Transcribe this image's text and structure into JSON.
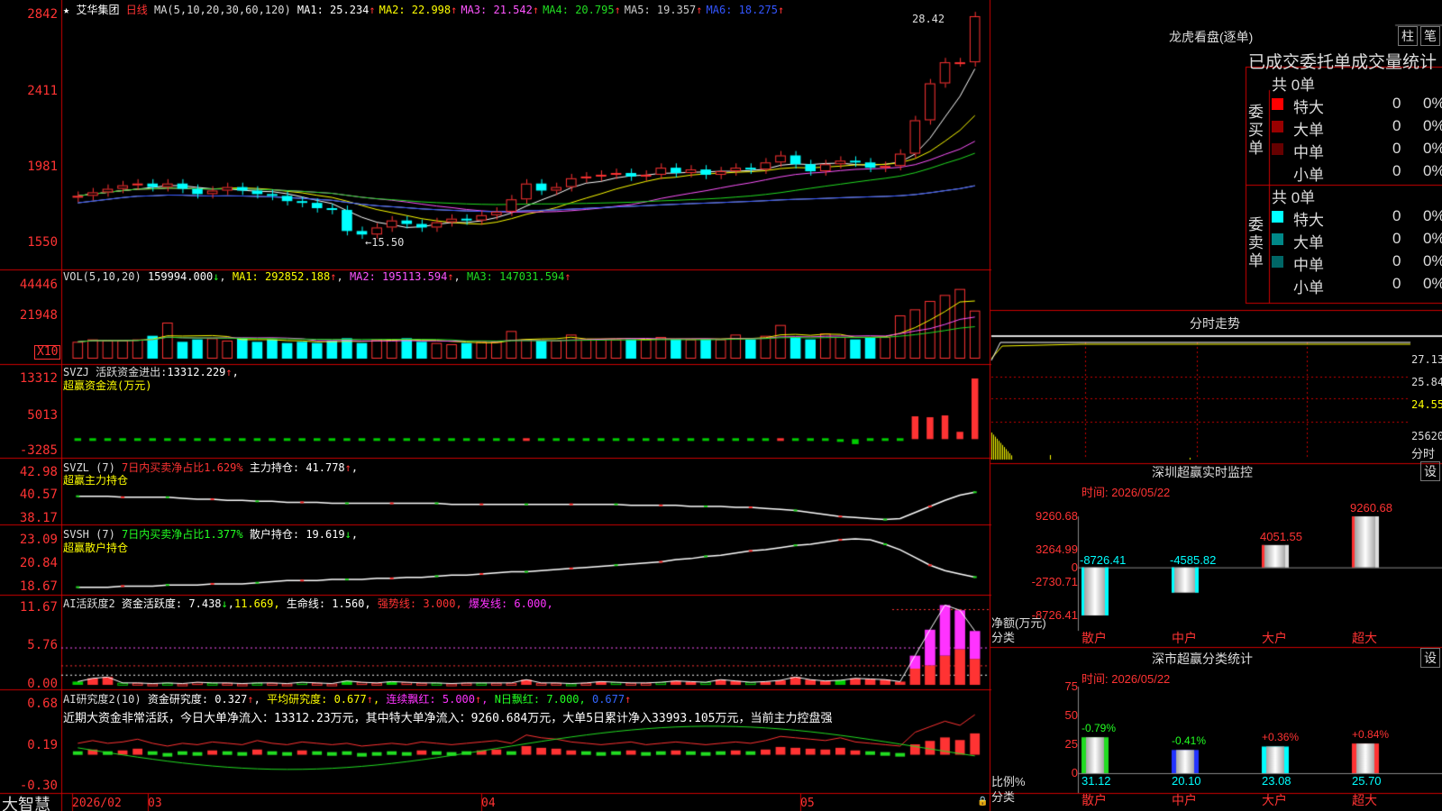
{
  "app": {
    "brand": "大智慧",
    "stock_name": "艾华集团",
    "period": "日线",
    "star": "★"
  },
  "price_panel": {
    "ma_label": "MA(5,10,20,30,60,120)",
    "ma_items": [
      {
        "name": "MA1:",
        "value": "25.234",
        "arrow": "↑",
        "color": "#ffffff"
      },
      {
        "name": "MA2:",
        "value": "22.998",
        "arrow": "↑",
        "color": "#ffff00"
      },
      {
        "name": "MA3:",
        "value": "21.542",
        "arrow": "↑",
        "color": "#ff55ff"
      },
      {
        "name": "MA4:",
        "value": "20.795",
        "arrow": "↑",
        "color": "#22dd22"
      },
      {
        "name": "MA5:",
        "value": "19.357",
        "arrow": "↑",
        "color": "#cccccc"
      },
      {
        "name": "MA6:",
        "value": "18.275",
        "arrow": "↑",
        "color": "#3355ff"
      }
    ],
    "axis": [
      "2842",
      "2411",
      "1981",
      "1550"
    ],
    "high_label": "28.42",
    "low_label": "←15.50"
  },
  "vol_panel": {
    "label": "VOL(5,10,20)",
    "value": "159994.000",
    "arrow": "↓",
    "items": [
      {
        "name": "MA1:",
        "value": "292852.188",
        "arrow": "↑",
        "color": "#ffff00"
      },
      {
        "name": "MA2:",
        "value": "195113.594",
        "arrow": "↑",
        "color": "#ff55ff"
      },
      {
        "name": "MA3:",
        "value": "147031.594",
        "arrow": "↑",
        "color": "#22dd22"
      }
    ],
    "axis": [
      "44446",
      "21948"
    ],
    "unit": "X10"
  },
  "svzj_panel": {
    "label": "SVZJ",
    "line1": "活跃资金进出:",
    "value": "13312.229",
    "arrow": "↑",
    "sep": ",",
    "line2": "超赢资金流(万元)",
    "axis": [
      "13312",
      "5013",
      "-3285"
    ]
  },
  "svzl_panel": {
    "label": "SVZL (7)",
    "text1": "7日内买卖净占比1.629%",
    "text2": "主力持仓:",
    "value": "41.778",
    "arrow": "↑",
    "sep": ",",
    "line2": "超赢主力持仓",
    "axis": [
      "42.98",
      "40.57",
      "38.17"
    ]
  },
  "svsh_panel": {
    "label": "SVSH (7)",
    "text1": "7日内买卖净占比1.377%",
    "text2": "散户持仓:",
    "value": "19.619",
    "arrow": "↓",
    "sep": ",",
    "line2": "超赢散户持仓",
    "axis": [
      "23.09",
      "20.84",
      "18.67"
    ]
  },
  "ai_panel": {
    "label": "AI活跃度2",
    "text1": "资金活跃度:",
    "v1": "7.438",
    "a1": "↓",
    "sep1": ",",
    "v2": "11.669",
    "text3": "生命线:",
    "v3": "1.560",
    "t4": "强势线:",
    "v4": "3.000",
    "t5": "爆发线:",
    "v5": "6.000",
    "sep": ",",
    "axis": [
      "11.67",
      "5.76",
      "0.00"
    ]
  },
  "research_panel": {
    "label": "AI研究度2(10)",
    "t1": "资金研究度:",
    "v1": "0.327",
    "a1": "↑",
    "t2": "平均研究度:",
    "v2": "0.677",
    "a2": "↑",
    "t3": "连续飘红:",
    "v3": "5.000",
    "a3": "↑",
    "t4": "N日飘红:",
    "v4": "7.000",
    "v5": "0.677",
    "a5": "↑",
    "sep": ",",
    "summary": "近期大资金非常活跃，今日大单净流入：13312.23万元，其中特大单净流入：9260.684万元，大单5日累计净入33993.105万元，当前主力控盘强",
    "axis": [
      "0.68",
      "0.19",
      "-0.30"
    ]
  },
  "dates": [
    "2026/02",
    "03",
    "04",
    "05"
  ],
  "right": {
    "dragon_title": "龙虎看盘(逐单)",
    "btn_bar": "柱",
    "btn_pen": "笔",
    "tabs": [
      "已成交委托单成交量统计"
    ],
    "buy": {
      "side": "委买单",
      "total": "共 0单",
      "rows": [
        {
          "label": "特大",
          "v": "0",
          "p": "0%",
          "color": "#ff0000"
        },
        {
          "label": "大单",
          "v": "0",
          "p": "0%",
          "color": "#990000"
        },
        {
          "label": "中单",
          "v": "0",
          "p": "0%",
          "color": "#660000"
        },
        {
          "label": "小单",
          "v": "0",
          "p": "0%",
          "color": ""
        }
      ]
    },
    "sell": {
      "side": "委卖单",
      "total": "共 0单",
      "rows": [
        {
          "label": "特大",
          "v": "0",
          "p": "0%",
          "color": "#00ffff"
        },
        {
          "label": "大单",
          "v": "0",
          "p": "0%",
          "color": "#008888"
        },
        {
          "label": "中单",
          "v": "0",
          "p": "0%",
          "color": "#006666"
        },
        {
          "label": "小单",
          "v": "0",
          "p": "0%",
          "color": ""
        }
      ]
    },
    "ts_title": "分时走势",
    "ts_axis": [
      "27.13",
      "25.84",
      "24.55",
      "25620"
    ],
    "ts_unit": "分时",
    "monitor": {
      "title": "深圳超赢实时监控",
      "btn": "设",
      "time": "时间: 2026/05/22",
      "axis": [
        "9260.68",
        "3264.99",
        "0",
        "-2730.71",
        "-8726.41"
      ],
      "ylabel": "净额(万元)",
      "xlabel": "分类",
      "cats": [
        "散户",
        "中户",
        "大户",
        "超大"
      ],
      "values": [
        -8726.41,
        -4585.82,
        4051.55,
        9260.68
      ],
      "labels": [
        "-8726.41",
        "-4585.82",
        "4051.55",
        "9260.68"
      ]
    },
    "stat": {
      "title": "深市超赢分类统计",
      "btn": "设",
      "time": "时间: 2026/05/22",
      "axis": [
        "75",
        "50",
        "25",
        "0"
      ],
      "ylabel": "比例%",
      "xlabel": "分类",
      "cats": [
        "散户",
        "中户",
        "大户",
        "超大"
      ],
      "values": [
        31.12,
        20.1,
        23.08,
        25.7
      ],
      "labels": [
        "31.12",
        "20.10",
        "23.08",
        "25.70"
      ],
      "changes": [
        "-0.79%",
        "-0.41%",
        "+0.36%",
        "+0.84%"
      ]
    }
  },
  "chart_data": {
    "type": "candlestick",
    "ylim": [
      15.5,
      28.42
    ],
    "closes": [
      18.2,
      18.4,
      18.6,
      18.8,
      18.9,
      18.7,
      18.9,
      18.6,
      18.3,
      18.5,
      18.7,
      18.5,
      18.3,
      18.2,
      17.9,
      17.8,
      17.5,
      17.4,
      16.2,
      16.0,
      16.4,
      16.8,
      16.6,
      16.4,
      16.7,
      16.9,
      16.8,
      17.1,
      17.3,
      18.0,
      18.9,
      18.5,
      18.7,
      19.2,
      19.3,
      19.4,
      19.5,
      19.3,
      19.4,
      19.8,
      19.5,
      19.7,
      19.4,
      19.6,
      19.8,
      19.7,
      20.1,
      20.5,
      20.0,
      19.6,
      20.0,
      20.2,
      20.1,
      19.8,
      19.9,
      20.6,
      22.5,
      24.6,
      25.8,
      25.8,
      28.42
    ],
    "volumes": [
      1.4,
      1.6,
      1.5,
      1.5,
      1.6,
      1.9,
      3.0,
      1.4,
      1.6,
      1.7,
      1.5,
      1.7,
      1.4,
      1.6,
      1.3,
      1.4,
      1.3,
      1.5,
      1.7,
      1.3,
      1.6,
      1.6,
      1.7,
      1.4,
      1.3,
      1.2,
      1.3,
      1.4,
      1.4,
      2.3,
      1.6,
      1.5,
      1.5,
      2.0,
      1.6,
      1.6,
      1.6,
      1.6,
      1.6,
      1.8,
      1.6,
      1.6,
      1.6,
      1.6,
      2.0,
      1.6,
      1.9,
      2.8,
      1.8,
      1.6,
      2.1,
      1.8,
      1.6,
      1.8,
      1.8,
      3.6,
      4.1,
      4.8,
      5.3,
      5.8,
      4.0
    ],
    "svzj": [
      -0.2,
      -0.1,
      -0.2,
      -0.2,
      -0.1,
      -0.3,
      -0.1,
      -0.2,
      -0.2,
      -0.2,
      -0.3,
      -0.2,
      -0.2,
      -0.3,
      -0.2,
      -0.2,
      -0.2,
      -0.3,
      -0.2,
      -0.3,
      -0.2,
      -0.2,
      -0.2,
      -0.2,
      -0.2,
      -0.2,
      -0.2,
      -0.2,
      -0.2,
      -0.3,
      0.3,
      -0.2,
      -0.2,
      -0.2,
      -0.2,
      -0.2,
      -0.2,
      -0.2,
      -0.2,
      -0.2,
      -0.2,
      -0.2,
      -0.2,
      -0.2,
      -0.2,
      -0.2,
      -0.2,
      0.3,
      -0.2,
      -0.2,
      -0.2,
      -0.6,
      -1.1,
      -0.3,
      -0.2,
      -0.2,
      5.0,
      4.8,
      5.2,
      1.6,
      13.3
    ],
    "zhuli": [
      40.6,
      40.6,
      40.6,
      40.5,
      40.5,
      40.5,
      40.5,
      40.4,
      40.3,
      40.3,
      40.2,
      40.2,
      40.1,
      40.1,
      40.0,
      40.0,
      40.0,
      39.9,
      39.9,
      39.9,
      39.9,
      39.9,
      39.9,
      39.9,
      39.9,
      39.8,
      39.8,
      39.8,
      39.8,
      39.8,
      39.8,
      39.8,
      39.8,
      39.8,
      39.8,
      39.8,
      39.8,
      39.7,
      39.7,
      39.7,
      39.7,
      39.6,
      39.6,
      39.6,
      39.5,
      39.5,
      39.4,
      39.3,
      39.2,
      39.0,
      38.8,
      38.6,
      38.5,
      38.4,
      38.3,
      38.4,
      39.0,
      39.6,
      40.2,
      40.7,
      41.0,
      41.778
    ],
    "sanhu": [
      18.7,
      18.7,
      18.7,
      18.8,
      18.8,
      18.8,
      18.9,
      18.9,
      18.9,
      19.0,
      19.0,
      19.0,
      19.1,
      19.2,
      19.3,
      19.3,
      19.3,
      19.4,
      19.4,
      19.4,
      19.5,
      19.5,
      19.6,
      19.6,
      19.7,
      19.8,
      19.8,
      19.9,
      20.0,
      20.1,
      20.1,
      20.2,
      20.3,
      20.4,
      20.5,
      20.6,
      20.7,
      20.8,
      20.9,
      21.0,
      21.2,
      21.3,
      21.5,
      21.6,
      21.8,
      22.0,
      22.1,
      22.3,
      22.5,
      22.6,
      22.8,
      23.0,
      23.1,
      23.0,
      22.6,
      22.1,
      21.4,
      20.7,
      20.2,
      19.9,
      19.619
    ],
    "ai": [
      0.5,
      1.0,
      1.2,
      0.3,
      0.3,
      0.2,
      0.3,
      0.2,
      0.4,
      0.3,
      0.3,
      0.2,
      0.3,
      0.3,
      0.2,
      0.4,
      0.3,
      0.2,
      0.6,
      0.4,
      0.3,
      0.5,
      0.4,
      0.3,
      0.3,
      0.2,
      0.3,
      0.3,
      0.3,
      0.3,
      0.8,
      0.3,
      0.3,
      0.2,
      0.3,
      0.5,
      0.4,
      0.3,
      0.3,
      0.4,
      0.6,
      0.5,
      0.4,
      0.8,
      0.6,
      0.4,
      0.5,
      0.7,
      1.2,
      0.8,
      0.6,
      0.7,
      1.0,
      0.9,
      0.8,
      0.5,
      2.5,
      3.0,
      4.5,
      5.5,
      4.0
    ],
    "ai2": [
      0,
      0,
      0,
      0,
      0,
      0,
      0,
      0,
      0,
      0,
      0,
      0,
      0,
      0,
      0,
      0,
      0,
      0,
      0,
      0,
      0,
      0,
      0,
      0,
      0,
      0,
      0,
      0,
      0,
      0,
      0,
      0,
      0,
      0,
      0,
      0,
      0,
      0,
      0,
      0,
      0,
      0,
      0,
      0,
      0,
      0,
      0,
      0,
      0,
      0,
      0,
      0,
      0,
      0,
      0,
      0,
      2.0,
      5.5,
      7.8,
      6.0,
      4.3
    ],
    "research": [
      0.12,
      0.14,
      0.12,
      0.13,
      0.15,
      0.12,
      0.1,
      0.12,
      0.11,
      0.13,
      0.12,
      0.11,
      0.14,
      0.12,
      0.11,
      0.13,
      0.12,
      0.11,
      0.12,
      0.1,
      0.11,
      0.12,
      0.11,
      0.13,
      0.12,
      0.11,
      0.12,
      0.13,
      0.14,
      0.12,
      0.18,
      0.16,
      0.15,
      0.13,
      0.12,
      0.11,
      0.12,
      0.13,
      0.11,
      0.12,
      0.13,
      0.12,
      0.11,
      0.12,
      0.13,
      0.12,
      0.14,
      0.17,
      0.16,
      0.15,
      0.14,
      0.16,
      0.13,
      0.12,
      0.11,
      0.1,
      0.2,
      0.24,
      0.28,
      0.25,
      0.327
    ]
  }
}
